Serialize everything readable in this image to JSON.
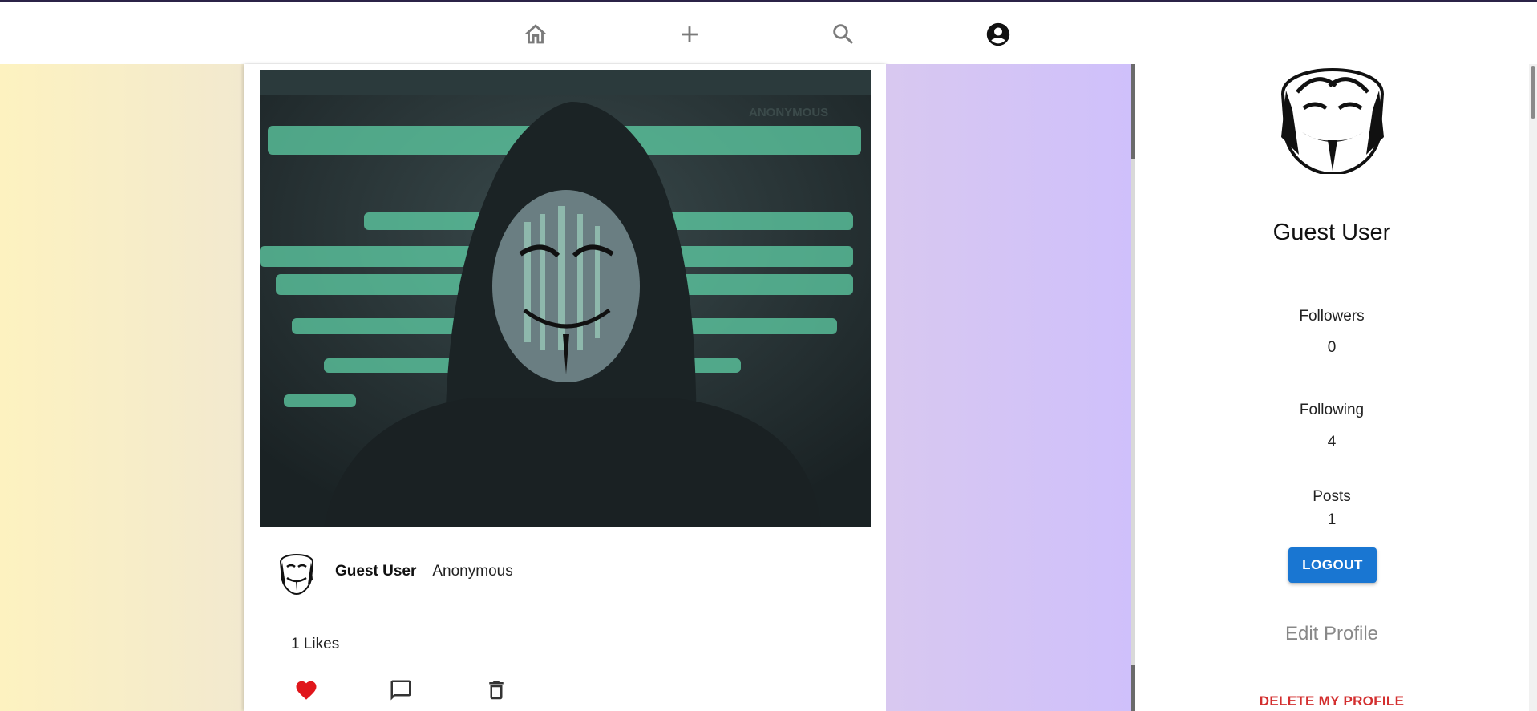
{
  "nav": {
    "items": [
      {
        "icon": "home-icon"
      },
      {
        "icon": "plus-icon"
      },
      {
        "icon": "search-icon"
      },
      {
        "icon": "account-circle-icon",
        "active": true
      }
    ]
  },
  "post": {
    "author": "Guest User",
    "caption": "Anonymous",
    "likes_text": "1 Likes",
    "image_watermark": "ANONYMOUS",
    "actions": [
      "heart-icon",
      "comment-icon",
      "trash-icon"
    ]
  },
  "profile": {
    "name": "Guest User",
    "followers_label": "Followers",
    "followers_value": "0",
    "following_label": "Following",
    "following_value": "4",
    "posts_label": "Posts",
    "posts_value": "1",
    "logout_label": "LOGOUT",
    "edit_label": "Edit Profile",
    "delete_label": "DELETE MY PROFILE"
  },
  "colors": {
    "accent": "#1976d2",
    "like": "#e0161b",
    "danger": "#d32f2f",
    "left_gradient": [
      "#fdf2c0",
      "#f2e9cf"
    ],
    "right_gradient": [
      "#d8c8f0",
      "#cfc0fb"
    ]
  }
}
